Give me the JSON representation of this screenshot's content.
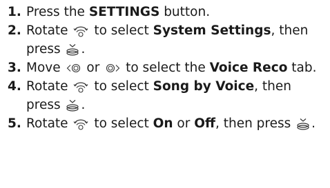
{
  "steps": [
    {
      "num": "1.",
      "t1": "Press the ",
      "b1": "SETTINGS",
      "t2": " button."
    },
    {
      "num": "2.",
      "t1": "Rotate ",
      "icon1": "interface-dial-rotate-icon",
      "t2": " to select ",
      "b1": "System Settings",
      "t3": ", then press ",
      "icon2": "interface-dial-press-icon",
      "t4": "."
    },
    {
      "num": "3.",
      "t1": "Move ",
      "icon1": "interface-dial-move-left-icon",
      "t2": " or ",
      "icon2": "interface-dial-move-right-icon",
      "t3": " to select the ",
      "b1": "Voice Reco",
      "t4": " tab."
    },
    {
      "num": "4.",
      "t1": "Rotate ",
      "icon1": "interface-dial-rotate-icon",
      "t2": " to select ",
      "b1": "Song by Voice",
      "t3": ", then press ",
      "icon2": "interface-dial-press-icon",
      "t4": "."
    },
    {
      "num": "5.",
      "t1": "Rotate ",
      "icon1": "interface-dial-rotate-icon",
      "t2": " to select ",
      "b1": "On",
      "t3": " or ",
      "b2": "Off",
      "t4": ", then press ",
      "icon2": "interface-dial-press-icon",
      "t5": "."
    }
  ]
}
